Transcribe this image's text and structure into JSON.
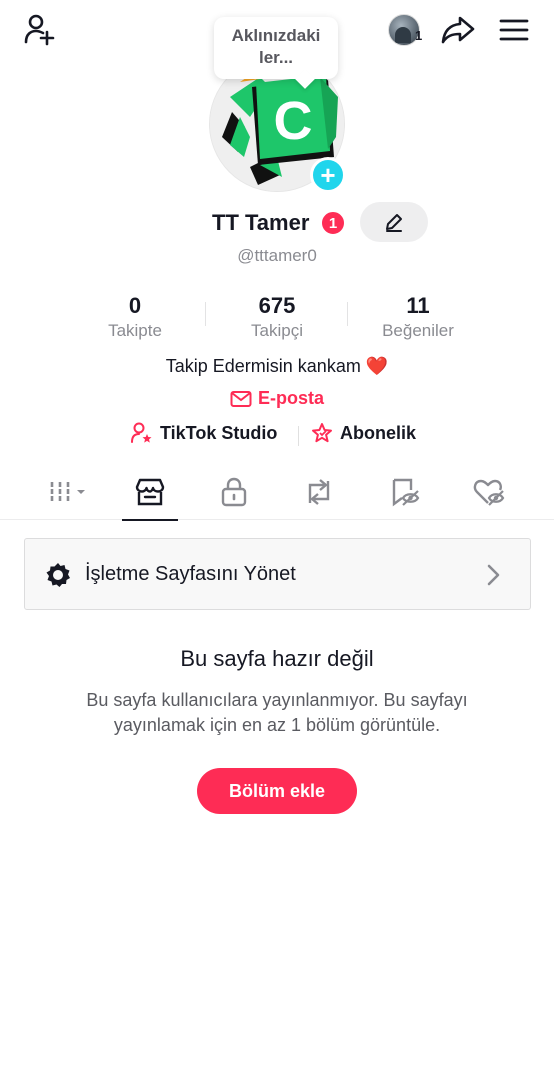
{
  "header": {
    "account_switch_count": "1",
    "tooltip_text": "Aklınızdaki ler..."
  },
  "profile": {
    "display_name": "TT Tamer",
    "notification_badge": "1",
    "username": "@tttamer0",
    "bio": "Takip Edermisin kankam ❤️",
    "email_label": "E-posta"
  },
  "stats": [
    {
      "value": "0",
      "label": "Takipte"
    },
    {
      "value": "675",
      "label": "Takipçi"
    },
    {
      "value": "11",
      "label": "Beğeniler"
    }
  ],
  "links": {
    "studio": "TikTok Studio",
    "subscription": "Abonelik"
  },
  "tabs": [
    {
      "icon": "grid-icon",
      "active": false
    },
    {
      "icon": "shop-icon",
      "active": true
    },
    {
      "icon": "lock-icon",
      "active": false
    },
    {
      "icon": "repost-icon",
      "active": false
    },
    {
      "icon": "hidden-bookmark-icon",
      "active": false
    },
    {
      "icon": "liked-heart-icon",
      "active": false
    }
  ],
  "manage": {
    "label": "İşletme Sayfasını Yönet"
  },
  "empty_state": {
    "title": "Bu sayfa hazır değil",
    "description": "Bu sayfa kullanıcılara yayınlanmıyor. Bu sayfayı yayınlamak için en az 1 bölüm görüntüle.",
    "button_label": "Bölüm ekle"
  },
  "colors": {
    "accent": "#fe2c55",
    "plus_badge": "#20d5ec",
    "avatar_green": "#1ec66a"
  }
}
